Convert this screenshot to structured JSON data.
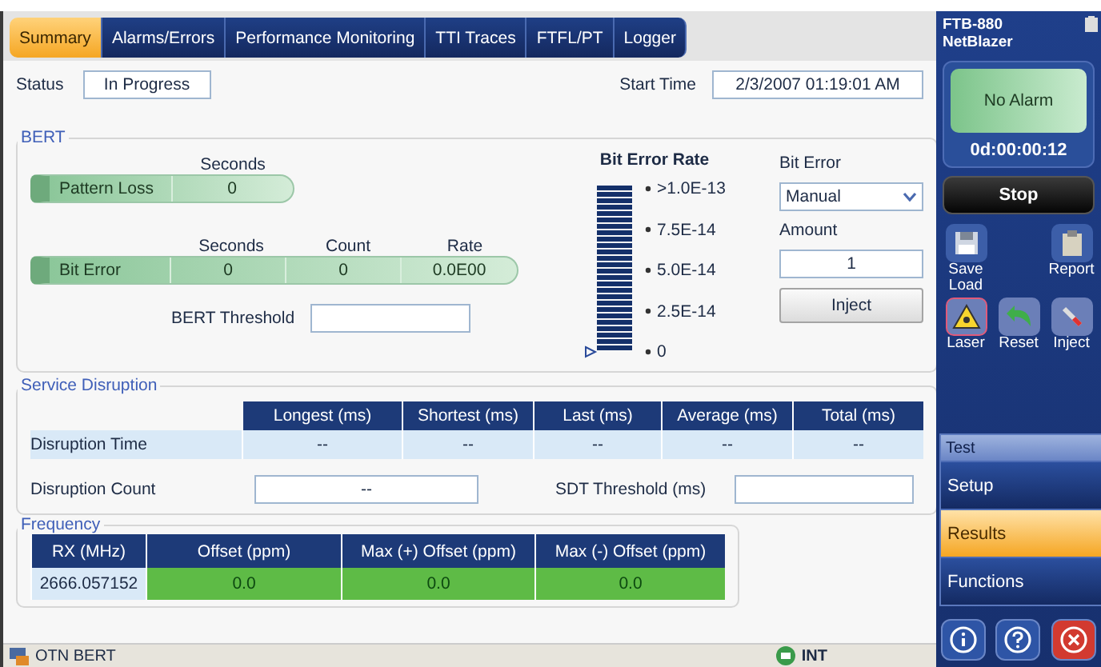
{
  "tabs": [
    {
      "label": "Summary",
      "selected": true
    },
    {
      "label": "Alarms/Errors",
      "selected": false
    },
    {
      "label": "Performance Monitoring",
      "selected": false
    },
    {
      "label": "TTI  Traces",
      "selected": false
    },
    {
      "label": "FTFL/PT",
      "selected": false
    },
    {
      "label": "Logger",
      "selected": false
    }
  ],
  "status": {
    "label": "Status",
    "value": "In Progress"
  },
  "start_time": {
    "label": "Start Time",
    "value": "2/3/2007 01:19:01 AM"
  },
  "bert": {
    "title": "BERT",
    "pattern_loss": {
      "header": "Seconds",
      "label": "Pattern Loss",
      "value": "0"
    },
    "bit_error": {
      "headers": [
        "Seconds",
        "Count",
        "Rate"
      ],
      "label": "Bit Error",
      "values": [
        "0",
        "0",
        "0.0E00"
      ]
    },
    "threshold": {
      "label": "BERT Threshold"
    },
    "rate_meter": {
      "title": "Bit Error Rate",
      "scale": [
        ">1.0E-13",
        "7.5E-14",
        "5.0E-14",
        "2.5E-14",
        "0"
      ]
    },
    "injection": {
      "label": "Bit Error",
      "mode": "Manual",
      "amount_label": "Amount",
      "amount": "1",
      "button": "Inject"
    }
  },
  "service_disruption": {
    "title": "Service Disruption",
    "columns": [
      "Longest (ms)",
      "Shortest (ms)",
      "Last (ms)",
      "Average (ms)",
      "Total (ms)"
    ],
    "rows": [
      {
        "label": "Disruption Time",
        "values": [
          "--",
          "--",
          "--",
          "--",
          "--"
        ]
      }
    ],
    "count": {
      "label": "Disruption Count",
      "value": "--"
    },
    "sdt_threshold": {
      "label": "SDT Threshold (ms)"
    }
  },
  "frequency": {
    "title": "Frequency",
    "columns": [
      "RX (MHz)",
      "Offset (ppm)",
      "Max (+) Offset (ppm)",
      "Max (-) Offset (ppm)"
    ],
    "values": [
      "2666.057152",
      "0.0",
      "0.0",
      "0.0"
    ]
  },
  "sidebar": {
    "device": "FTB-880",
    "model": "NetBlazer",
    "alarm": "No Alarm",
    "timer": "0d:00:00:12",
    "stop": "Stop",
    "tools": [
      {
        "kind": "save",
        "label": "Save Load"
      },
      {
        "kind": "report",
        "label": "Report"
      },
      {
        "kind": "laser",
        "label": "Laser"
      },
      {
        "kind": "reset",
        "label": "Reset"
      },
      {
        "kind": "inject",
        "label": "Inject"
      }
    ],
    "section": "Test",
    "nav": [
      {
        "label": "Setup",
        "selected": false
      },
      {
        "label": "Results",
        "selected": true
      },
      {
        "label": "Functions",
        "selected": false
      }
    ],
    "bottom_buttons": [
      {
        "kind": "info"
      },
      {
        "kind": "help"
      },
      {
        "kind": "close"
      }
    ]
  },
  "status_bar": {
    "test": "OTN BERT",
    "clock": "INT"
  }
}
